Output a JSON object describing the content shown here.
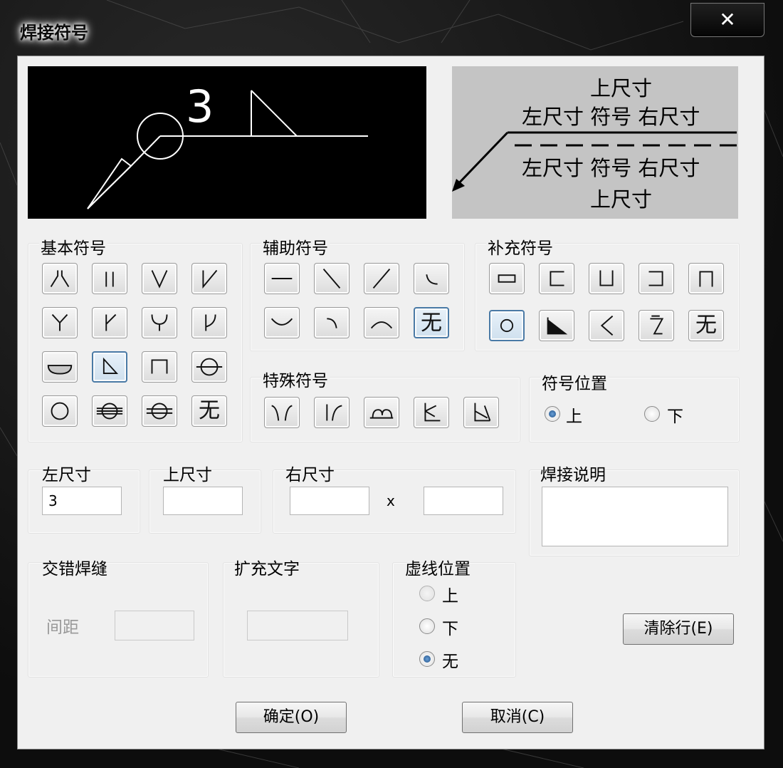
{
  "window": {
    "title": "焊接符号",
    "close_label": "✕"
  },
  "preview": {
    "dimension_text": "3"
  },
  "legend": {
    "top_line1": "上尺寸",
    "top_line2": "左尺寸 符号 右尺寸",
    "bottom_line1": "左尺寸 符号 右尺寸",
    "bottom_line2": "上尺寸"
  },
  "basic_symbols": {
    "label": "基本符号",
    "items": [
      {
        "icon": "bevel-pair-icon"
      },
      {
        "icon": "square-butt-icon"
      },
      {
        "icon": "v-groove-icon"
      },
      {
        "icon": "single-bevel-icon"
      },
      {
        "icon": "y-groove-icon"
      },
      {
        "icon": "single-bevel-y-icon"
      },
      {
        "icon": "u-groove-icon"
      },
      {
        "icon": "j-groove-icon"
      },
      {
        "icon": "backing-run-icon"
      },
      {
        "icon": "fillet-icon"
      },
      {
        "icon": "plug-weld-icon"
      },
      {
        "icon": "spot-weld-icon"
      },
      {
        "icon": "seam-circle-icon"
      },
      {
        "icon": "surfacing-icon"
      },
      {
        "icon": "edge-seam-icon"
      },
      {
        "text": "无"
      }
    ],
    "selected_index": 9
  },
  "auxiliary_symbols": {
    "label": "辅助符号",
    "items": [
      {
        "icon": "flat-icon"
      },
      {
        "icon": "backslash-icon"
      },
      {
        "icon": "slash-icon"
      },
      {
        "icon": "curve-corner-icon"
      },
      {
        "icon": "concave-icon"
      },
      {
        "icon": "hook-icon"
      },
      {
        "icon": "convex-icon"
      },
      {
        "text": "无"
      }
    ],
    "selected_index": 7
  },
  "supplementary_symbols": {
    "label": "补充符号",
    "items": [
      {
        "icon": "rectangle-icon"
      },
      {
        "icon": "three-side-left-icon"
      },
      {
        "icon": "three-side-bottom-icon"
      },
      {
        "icon": "three-side-right-icon"
      },
      {
        "icon": "three-side-top-icon"
      },
      {
        "icon": "circle-icon"
      },
      {
        "icon": "flag-icon"
      },
      {
        "icon": "angle-icon"
      },
      {
        "icon": "z-icon"
      },
      {
        "text": "无"
      }
    ],
    "selected_index": 5
  },
  "special_symbols": {
    "label": "特殊符号",
    "items": [
      {
        "icon": "flare-v-icon"
      },
      {
        "icon": "flare-bevel-icon"
      },
      {
        "icon": "edge-flange-icon"
      },
      {
        "icon": "k-joint-icon"
      },
      {
        "icon": "special-joint-icon"
      }
    ]
  },
  "symbol_position": {
    "label": "符号位置",
    "options": [
      "上",
      "下"
    ],
    "selected": "上"
  },
  "left_dim": {
    "label": "左尺寸",
    "value": "3"
  },
  "top_dim": {
    "label": "上尺寸",
    "value": ""
  },
  "right_dim": {
    "label": "右尺寸",
    "value1": "",
    "separator": "x",
    "value2": ""
  },
  "weld_note": {
    "label": "焊接说明",
    "value": ""
  },
  "staggered": {
    "label": "交错焊缝",
    "spacing_label": "间距",
    "spacing_value": ""
  },
  "extra_text": {
    "label": "扩充文字",
    "value": ""
  },
  "dash_position": {
    "label": "虚线位置",
    "options": [
      "上",
      "下",
      "无"
    ],
    "selected": "无"
  },
  "buttons": {
    "clear": "清除行(E)",
    "ok": "确定(O)",
    "cancel": "取消(C)"
  }
}
